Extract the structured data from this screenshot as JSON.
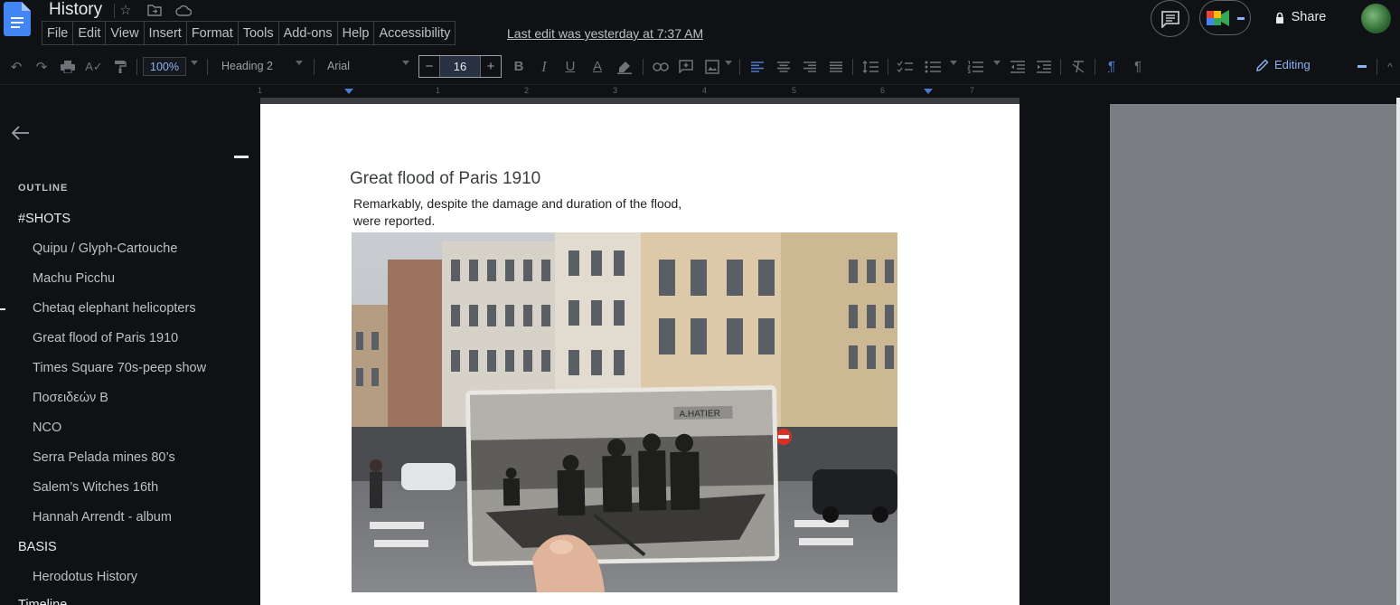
{
  "header": {
    "title": "History",
    "menu": [
      "File",
      "Edit",
      "View",
      "Insert",
      "Format",
      "Tools",
      "Add-ons",
      "Help",
      "Accessibility"
    ],
    "last_edit": "Last edit was yesterday at 7:37 AM",
    "share_label": "Share"
  },
  "toolbar": {
    "zoom": "100%",
    "style": "Heading 2",
    "font": "Arial",
    "font_size": "16",
    "mode": "Editing"
  },
  "ruler": {
    "numbers": [
      "1",
      "1",
      "2",
      "3",
      "4",
      "5",
      "6",
      "7"
    ]
  },
  "outline": {
    "label": "OUTLINE",
    "items": [
      {
        "text": "#SHOTS",
        "level": 1
      },
      {
        "text": "Quipu / Glyph-Cartouche",
        "level": 2
      },
      {
        "text": "Machu Picchu",
        "level": 2
      },
      {
        "text": "Chetaq elephant helicopters",
        "level": 2
      },
      {
        "text": "Great flood of Paris 1910",
        "level": 2
      },
      {
        "text": "Times Square 70s-peep show",
        "level": 2
      },
      {
        "text": "Ποσειδεών Β",
        "level": 2
      },
      {
        "text": "NCO",
        "level": 2
      },
      {
        "text": "Serra Pelada mines 80’s",
        "level": 2
      },
      {
        "text": "Salem’s Witches 16th",
        "level": 2
      },
      {
        "text": "Hannah Arrendt - album",
        "level": 2
      },
      {
        "text": "BASIS",
        "level": 1
      },
      {
        "text": "Herodotus History",
        "level": 2
      },
      {
        "text": "Timeline",
        "level": 1
      }
    ]
  },
  "document": {
    "heading": "Great flood of Paris 1910",
    "body_line1": "Remarkably, despite the damage and duration of the flood,",
    "body_line2": "were reported.",
    "photo_sign": "A.HATIER"
  }
}
